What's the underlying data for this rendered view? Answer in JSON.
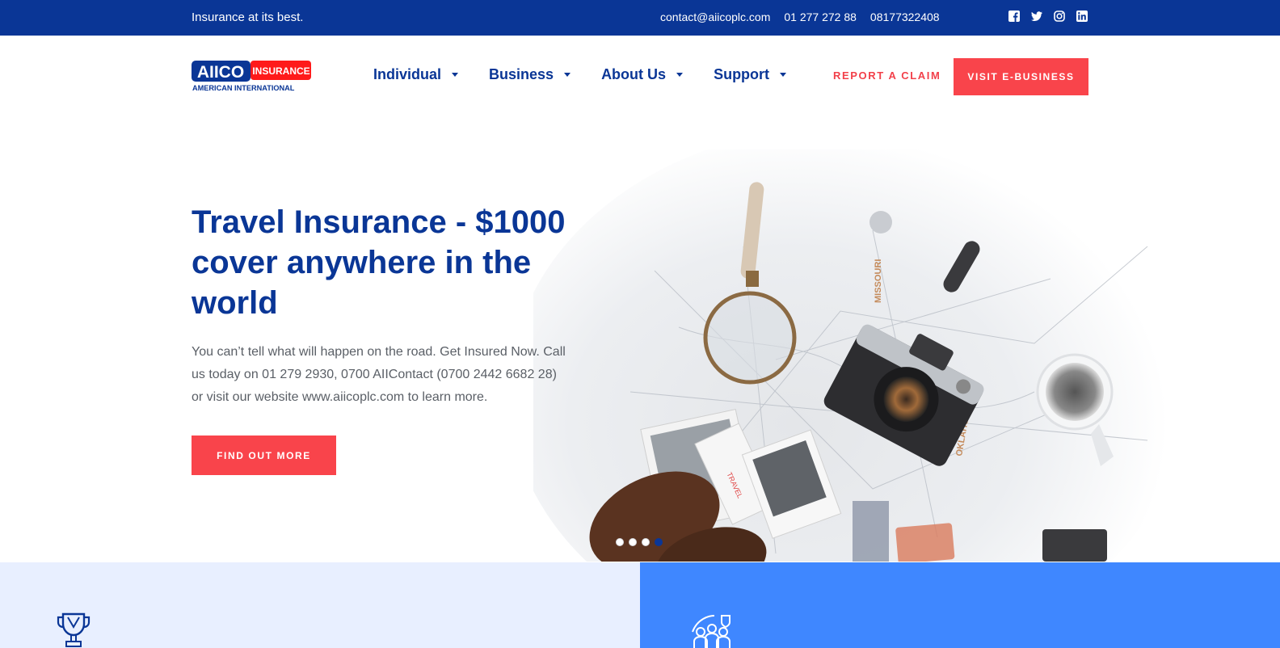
{
  "topbar": {
    "tagline": "Insurance at its best.",
    "email": "contact@aiicoplc.com",
    "phone1": "01 277 272 88",
    "phone2": "08177322408",
    "socials": [
      "facebook-icon",
      "twitter-icon",
      "instagram-icon",
      "linkedin-icon"
    ]
  },
  "logo": {
    "brand": "AIICO",
    "badge": "INSURANCE",
    "subtitle": "AMERICAN INTERNATIONAL"
  },
  "nav": {
    "items": [
      {
        "label": "Individual"
      },
      {
        "label": "Business"
      },
      {
        "label": "About Us"
      },
      {
        "label": "Support"
      }
    ]
  },
  "header": {
    "report_claim": "REPORT A CLAIM",
    "visit_ebusiness": "VISIT E-BUSINESS"
  },
  "hero": {
    "title": "Travel Insurance - $1000 cover anywhere in the world",
    "body": "You can’t tell what will happen on the road. Get Insured Now. Call us today on 01 279 2930, 0700 AIIContact (0700 2442 6682 28) or visit our website www.aiicoplc.com to learn more.",
    "cta": "FIND OUT MORE",
    "slides_total": 4,
    "active_slide": 4
  },
  "colors": {
    "primary": "#0a3696",
    "accent": "#f9444b",
    "panel_light": "#e8efff",
    "panel_blue": "#3f87ff"
  },
  "panels": {
    "left_icon": "trophy-icon",
    "right_icon": "family-shield-icon"
  }
}
